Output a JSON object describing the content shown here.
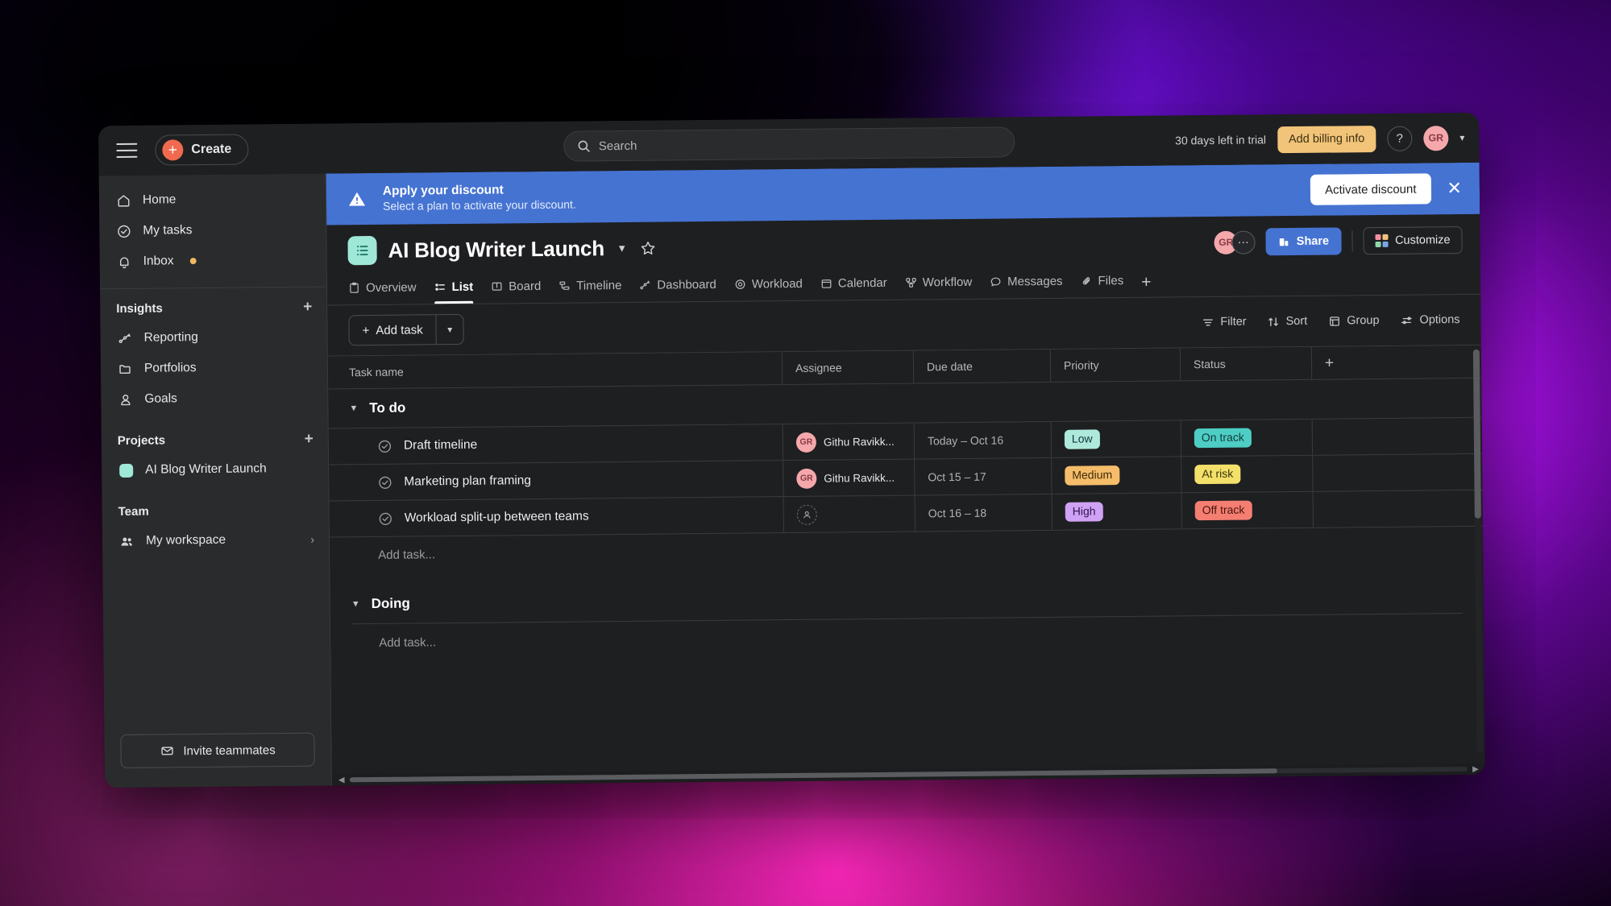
{
  "topbar": {
    "menu_icon": "hamburger-icon",
    "create_label": "Create",
    "search_placeholder": "Search",
    "trial_text": "30 days left in trial",
    "billing_label": "Add billing info",
    "help_label": "?",
    "avatar_initials": "GR"
  },
  "sidebar": {
    "primary_items": [
      {
        "label": "Home",
        "icon": "home-icon"
      },
      {
        "label": "My tasks",
        "icon": "check-circle-icon"
      },
      {
        "label": "Inbox",
        "icon": "bell-icon",
        "badge": true
      }
    ],
    "insights": {
      "title": "Insights",
      "add_label": "+",
      "items": [
        {
          "label": "Reporting",
          "icon": "reporting-icon"
        },
        {
          "label": "Portfolios",
          "icon": "folder-icon"
        },
        {
          "label": "Goals",
          "icon": "goals-icon"
        }
      ]
    },
    "projects": {
      "title": "Projects",
      "add_label": "+",
      "items": [
        {
          "label": "AI Blog Writer Launch",
          "color": "#9fe8d8"
        }
      ]
    },
    "team": {
      "title": "Team",
      "items": [
        {
          "label": "My workspace",
          "icon": "people-icon"
        }
      ]
    },
    "invite_label": "Invite teammates"
  },
  "banner": {
    "title": "Apply your discount",
    "subtitle": "Select a plan to activate your discount.",
    "action_label": "Activate discount",
    "close_label": "✕",
    "background": "#4573d2"
  },
  "project": {
    "title": "AI Blog Writer Launch",
    "icon_color": "#9fe8d8",
    "avatar_initials": "GR",
    "more_label": "⋯",
    "share_label": "Share",
    "customize_label": "Customize"
  },
  "tabs": [
    {
      "label": "Overview",
      "icon": "overview-icon",
      "active": false
    },
    {
      "label": "List",
      "icon": "list-icon",
      "active": true
    },
    {
      "label": "Board",
      "icon": "board-icon",
      "active": false
    },
    {
      "label": "Timeline",
      "icon": "timeline-icon",
      "active": false
    },
    {
      "label": "Dashboard",
      "icon": "dashboard-icon",
      "active": false
    },
    {
      "label": "Workload",
      "icon": "workload-icon",
      "active": false
    },
    {
      "label": "Calendar",
      "icon": "calendar-icon",
      "active": false
    },
    {
      "label": "Workflow",
      "icon": "workflow-icon",
      "active": false
    },
    {
      "label": "Messages",
      "icon": "messages-icon",
      "active": false
    },
    {
      "label": "Files",
      "icon": "files-icon",
      "active": false
    }
  ],
  "tab_add_label": "+",
  "toolbar": {
    "add_task_label": "Add task",
    "add_task_caret": "⌄",
    "filter_label": "Filter",
    "sort_label": "Sort",
    "group_label": "Group",
    "options_label": "Options"
  },
  "table": {
    "columns": [
      "Task name",
      "Assignee",
      "Due date",
      "Priority",
      "Status"
    ],
    "add_column_label": "+",
    "groups": [
      {
        "name": "To do",
        "add_task_placeholder": "Add task...",
        "rows": [
          {
            "task": "Draft timeline",
            "assignee": "Githu Ravikk...",
            "assignee_initials": "GR",
            "due": "Today – Oct 16",
            "priority": "Low",
            "priority_bg": "#aee9dc",
            "priority_fg": "#14343a",
            "status": "On track",
            "status_bg": "#4ecdc4",
            "status_fg": "#123b38"
          },
          {
            "task": "Marketing plan framing",
            "assignee": "Githu Ravikk...",
            "assignee_initials": "GR",
            "due": "Oct 15 – 17",
            "priority": "Medium",
            "priority_bg": "#f5bd6a",
            "priority_fg": "#3d2a08",
            "status": "At risk",
            "status_bg": "#f2e06a",
            "status_fg": "#3d3508"
          },
          {
            "task": "Workload split-up between teams",
            "assignee": "",
            "assignee_initials": "",
            "due": "Oct 16 – 18",
            "priority": "High",
            "priority_bg": "#cfa2f5",
            "priority_fg": "#31134f",
            "status": "Off track",
            "status_bg": "#f47e72",
            "status_fg": "#4a140d"
          }
        ]
      },
      {
        "name": "Doing",
        "add_task_placeholder": "Add task...",
        "rows": []
      }
    ]
  }
}
